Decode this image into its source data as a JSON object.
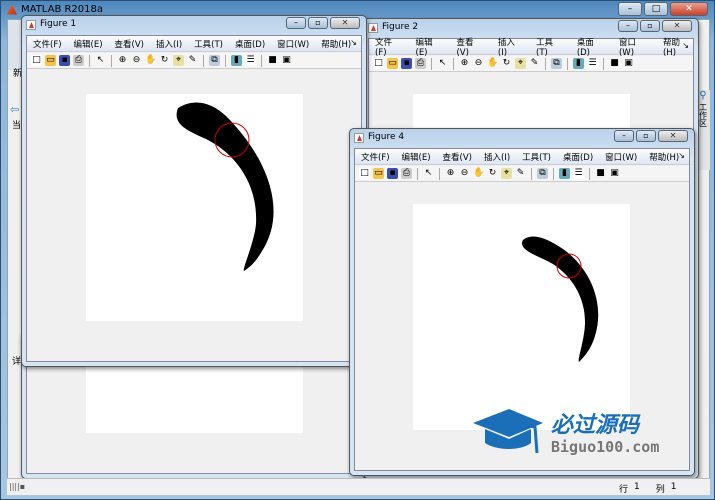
{
  "app": {
    "title": "MATLAB R2018a",
    "left_partial": [
      "新",
      "当",
      "详"
    ],
    "right_panel_label": "工作区"
  },
  "menu": [
    "文件(F)",
    "编辑(E)",
    "查看(V)",
    "插入(I)",
    "工具(T)",
    "桌面(D)",
    "窗口(W)",
    "帮助(H)"
  ],
  "toolbar_icons": [
    "new-figure",
    "open",
    "save",
    "print",
    "pointer",
    "zoom-in",
    "zoom-out",
    "pan",
    "rotate-3d",
    "data-cursor",
    "brush",
    "link",
    "colorbar",
    "legend",
    "hide-plot-tools",
    "show-plot-tools"
  ],
  "figures": [
    {
      "title": "Figure 1"
    },
    {
      "title": "Figure 2"
    },
    {
      "title": "Figure 4"
    }
  ],
  "status": {
    "row_label": "行",
    "row": "1",
    "col_label": "列",
    "col": "1"
  },
  "watermark": {
    "cn": "必过源码",
    "en": "Biguo100.com"
  },
  "colors": {
    "circle": "#cc0000",
    "shape": "#000000",
    "watermark": "#1a6fb8"
  }
}
